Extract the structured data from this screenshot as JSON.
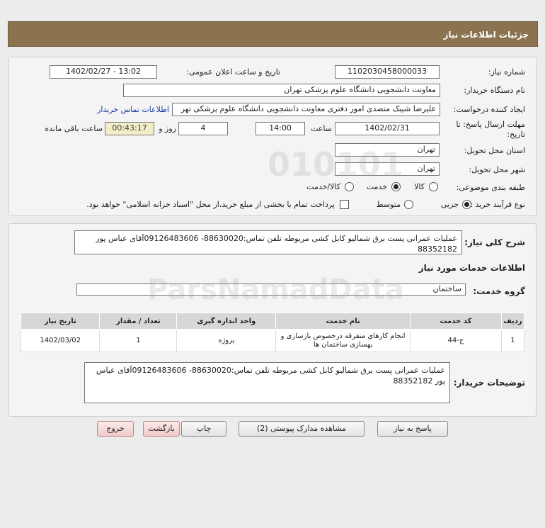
{
  "header": {
    "title": "جزئیات اطلاعات نیاز"
  },
  "form": {
    "need_number_label": "شماره نیاز:",
    "need_number": "1102030458000033",
    "announce_label": "تاریخ و ساعت اعلان عمومی:",
    "announce_value": "1402/02/27 - 13:02",
    "buyer_label": "نام دستگاه خریدار:",
    "buyer_value": "معاونت دانشجویی دانشگاه علوم پزشکی تهران",
    "creator_label": "ایجاد کننده درخواست:",
    "creator_value": "علیرضا شیبک متصدی امور دفتری معاونت دانشجویی دانشگاه علوم پزشکی تهر",
    "contact_link": "اطلاعات تماس خریدار",
    "deadline_label_1": "مهلت ارسال پاسخ: تا",
    "deadline_label_2": "تاریخ:",
    "deadline_date": "1402/02/31",
    "time_label": "ساعت",
    "deadline_time": "14:00",
    "days_value": "4",
    "days_label": "روز و",
    "remaining_time": "00:43:17",
    "remaining_label": "ساعت باقی مانده",
    "province_label": "استان محل تحویل:",
    "province_value": "تهران",
    "city_label": "شهر محل تحویل:",
    "city_value": "تهران",
    "category_label": "طبقه بندی موضوعی:",
    "category_options": [
      "کالا",
      "خدمت",
      "کالا/خدمت"
    ],
    "category_selected": "خدمت",
    "process_label": "نوع فرآیند خرید :",
    "process_options": [
      "جزیی",
      "متوسط"
    ],
    "process_selected": "جزیی",
    "payment_note": "پرداخت تمام یا بخشی از مبلغ خرید،از محل \"اسناد خزانه اسلامی\" خواهد بود."
  },
  "details": {
    "summary_label": "شرح کلی نیاز:",
    "summary_value": "عملیات عمرانی پست برق شمالیو کابل کشی مربوطه تلفن تماس:88630020- 09126483606آقای عباس پور  88352182",
    "services_title": "اطلاعات خدمات مورد نیاز",
    "service_group_label": "گروه خدمت:",
    "service_group_value": "ساختمان",
    "table": {
      "headers": [
        "ردیف",
        "کد خدمت",
        "نام خدمت",
        "واحد اندازه گیری",
        "تعداد / مقدار",
        "تاریخ نیاز"
      ],
      "rows": [
        [
          "1",
          "ج-44",
          "انجام کارهای متفرقه درخصوص بازسازی و بهسازی ساختمان ها",
          "پروژه",
          "1",
          "1402/03/02"
        ]
      ]
    },
    "buyer_notes_label": "توضیحات خریدار:",
    "buyer_notes_value": "عملیات عمرانی پست برق شمالیو کابل کشی مربوطه تلفن تماس:88630020- 09126483606آقای عباس پور  88352182"
  },
  "buttons": {
    "reply": "پاسخ به نیاز",
    "attachments": "مشاهده مدارک پیوستی (2)",
    "print": "چاپ",
    "back": "بازگشت",
    "exit": "خروج"
  },
  "watermark": {
    "brand": "ParsNamadData"
  }
}
